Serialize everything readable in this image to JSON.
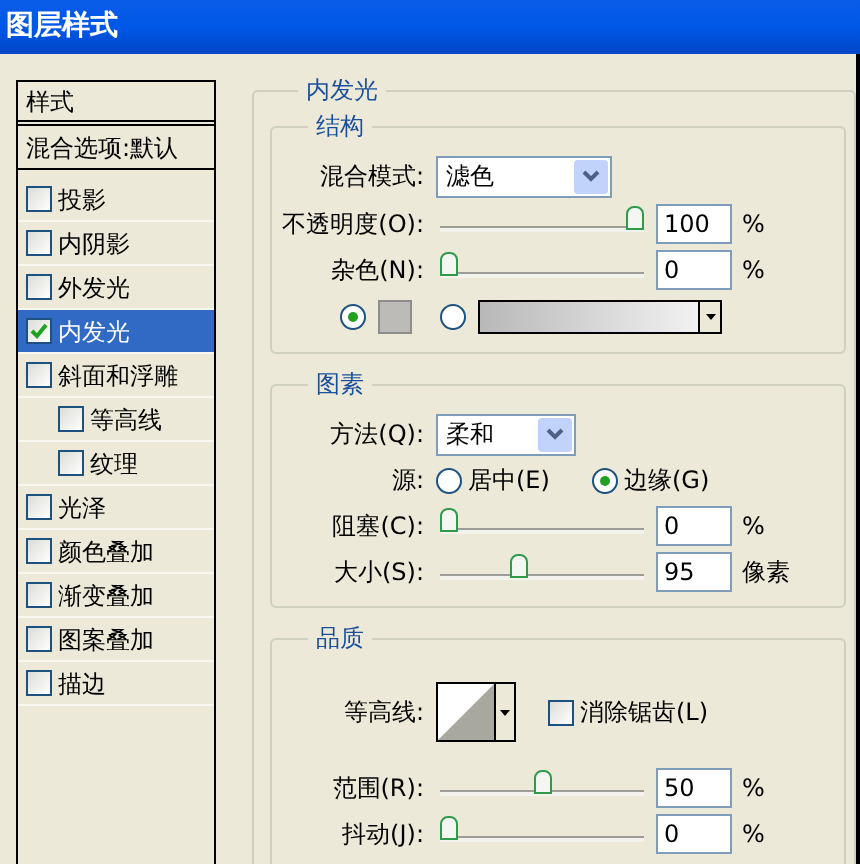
{
  "window": {
    "title": "图层样式"
  },
  "sidebar": {
    "header": "样式",
    "blend_options": "混合选项:默认",
    "items": [
      {
        "label": "投影",
        "checked": false,
        "selected": false
      },
      {
        "label": "内阴影",
        "checked": false,
        "selected": false
      },
      {
        "label": "外发光",
        "checked": false,
        "selected": false
      },
      {
        "label": "内发光",
        "checked": true,
        "selected": true
      },
      {
        "label": "斜面和浮雕",
        "checked": false,
        "selected": false,
        "children": [
          {
            "label": "等高线",
            "checked": false,
            "selected": false
          },
          {
            "label": "纹理",
            "checked": false,
            "selected": false
          }
        ]
      },
      {
        "label": "光泽",
        "checked": false,
        "selected": false
      },
      {
        "label": "颜色叠加",
        "checked": false,
        "selected": false
      },
      {
        "label": "渐变叠加",
        "checked": false,
        "selected": false
      },
      {
        "label": "图案叠加",
        "checked": false,
        "selected": false
      },
      {
        "label": "描边",
        "checked": false,
        "selected": false
      }
    ]
  },
  "panel": {
    "title": "内发光",
    "structure": {
      "title": "结构",
      "blend_mode": {
        "label": "混合模式:",
        "value": "滤色"
      },
      "opacity": {
        "label": "不透明度(O):",
        "level": 1,
        "value": "100",
        "unit": "%"
      },
      "noise": {
        "label": "杂色(N):",
        "level": 0,
        "value": "0",
        "unit": "%"
      },
      "fill": [
        {
          "kind": "color",
          "selected": true
        },
        {
          "kind": "gradient",
          "selected": false
        }
      ]
    },
    "elements": {
      "title": "图素",
      "technique": {
        "label": "方法(Q):",
        "value": "柔和"
      },
      "source": {
        "label": "源:",
        "options": [
          {
            "label": "居中(E)",
            "selected": false
          },
          {
            "label": "边缘(G)",
            "selected": true
          }
        ]
      },
      "choke": {
        "label": "阻塞(C):",
        "level": 0,
        "value": "0",
        "unit": "%"
      },
      "size": {
        "label": "大小(S):",
        "level": 0.38,
        "value": "95",
        "unit": "像素"
      }
    },
    "quality": {
      "title": "品质",
      "contour": {
        "label": "等高线:"
      },
      "anti_alias": {
        "label": "消除锯齿(L)",
        "checked": false
      },
      "range": {
        "label": "范围(R):",
        "level": 0.5,
        "value": "50",
        "unit": "%"
      },
      "jitter": {
        "label": "抖动(J):",
        "level": 0,
        "value": "0",
        "unit": "%"
      }
    }
  }
}
